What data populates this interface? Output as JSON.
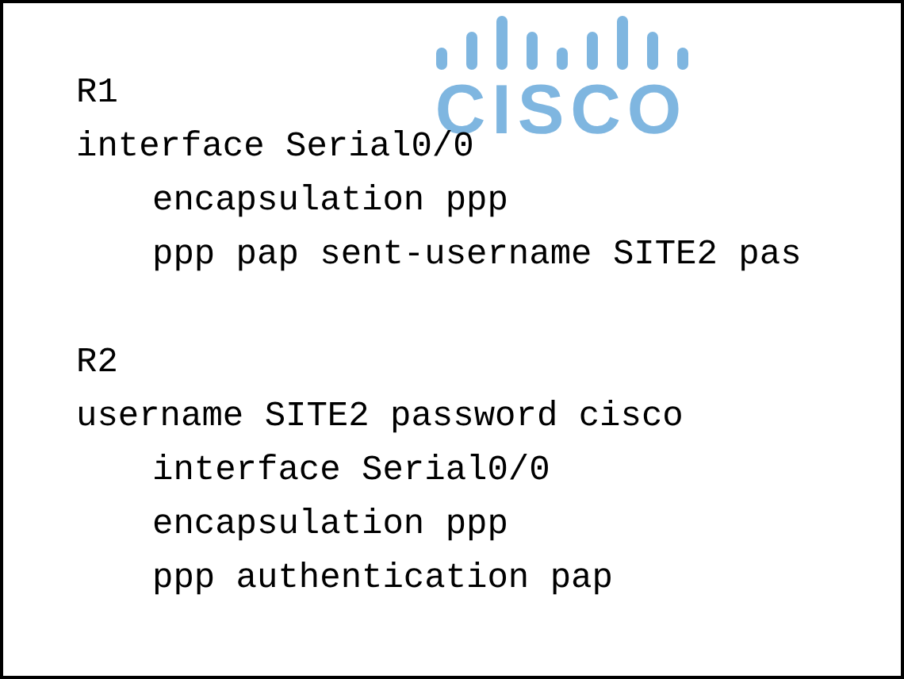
{
  "logo": {
    "text": "CISCO"
  },
  "blocks": [
    {
      "title": "R1",
      "lines": [
        {
          "text": "interface Serial0/0",
          "children": [
            {
              "text": "encapsulation ppp"
            },
            {
              "text": "ppp pap sent-username SITE2 pas"
            }
          ]
        }
      ]
    },
    {
      "title": "R2",
      "lines": [
        {
          "text": "username SITE2 password cisco",
          "children": [
            {
              "text": "interface Serial0/0"
            },
            {
              "text": "encapsulation ppp"
            },
            {
              "text": "ppp authentication pap"
            }
          ]
        }
      ]
    }
  ]
}
